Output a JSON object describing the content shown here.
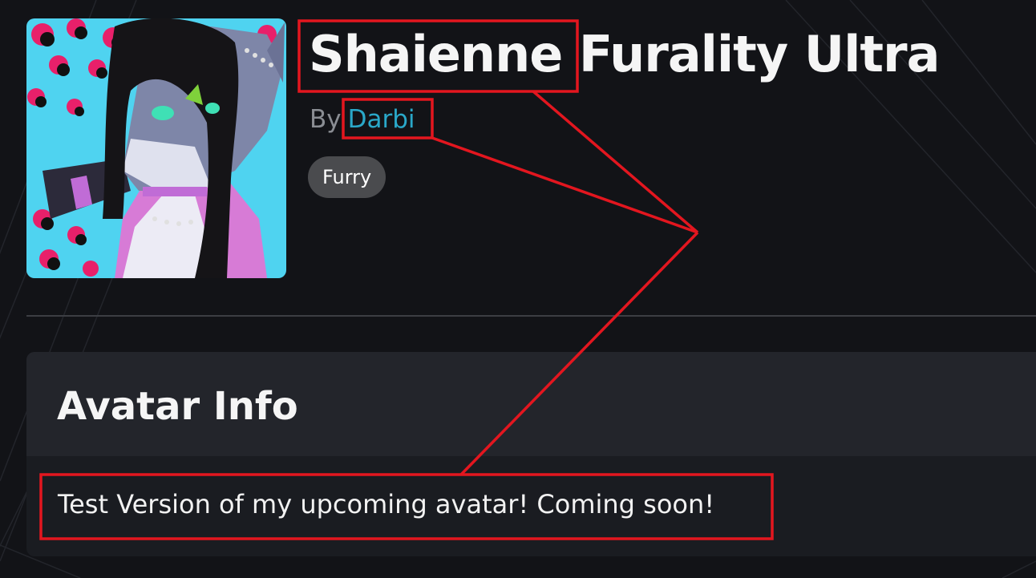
{
  "avatar": {
    "title": "Shaienne Furality Ultra",
    "byline_prefix": "By",
    "author": "Darbi",
    "tag": "Furry",
    "thumbnail_alt": "Avatar preview image"
  },
  "info_card": {
    "title": "Avatar Info",
    "description": "Test Version of my upcoming avatar! Coming soon!"
  },
  "colors": {
    "background": "#121317",
    "author_link": "#2aa8c9",
    "annotation": "#e3161f",
    "tag_background": "#4a4b4e"
  }
}
